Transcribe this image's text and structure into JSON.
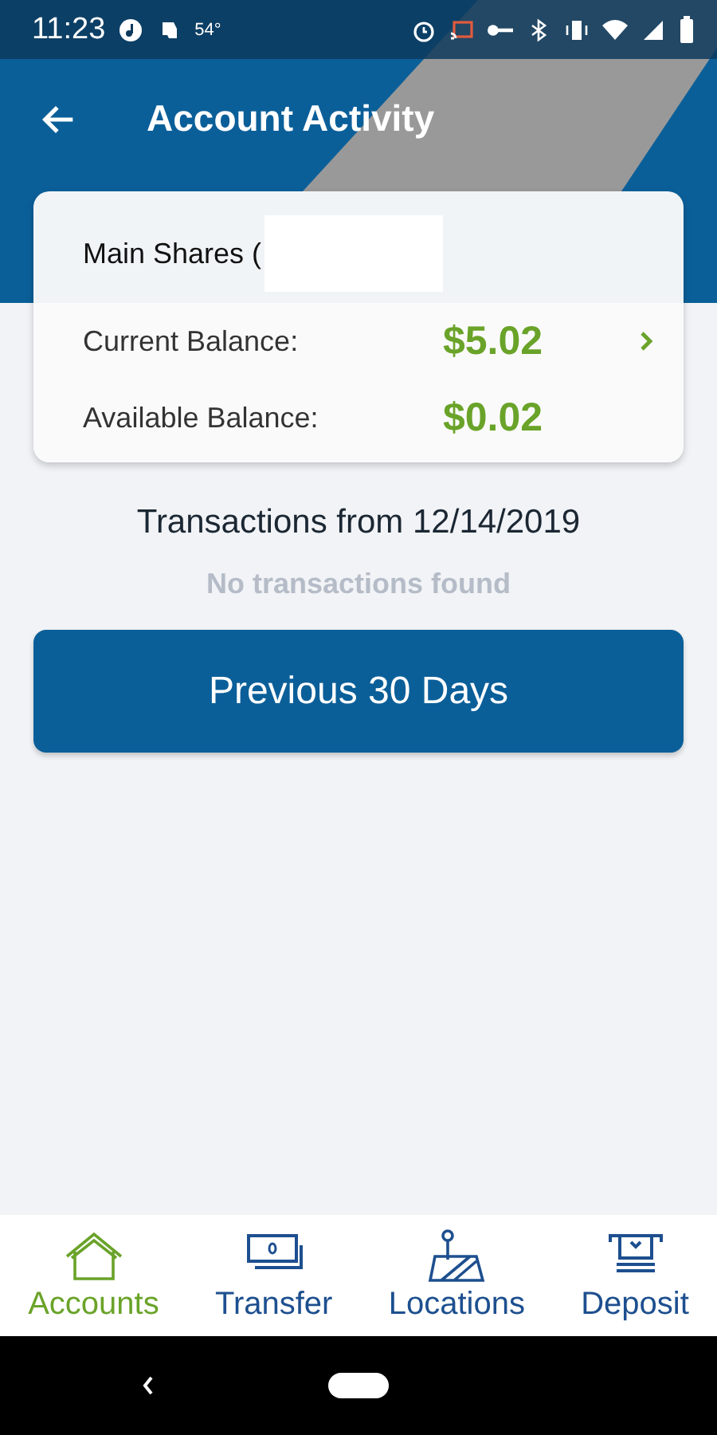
{
  "status_bar": {
    "time": "11:23",
    "temperature": "54°"
  },
  "header": {
    "title": "Account Activity"
  },
  "account": {
    "name": "Main Shares (",
    "balances": [
      {
        "label": "Current Balance:",
        "amount": "$5.02",
        "link": true
      },
      {
        "label": "Available Balance:",
        "amount": "$0.02",
        "link": false
      }
    ]
  },
  "transactions": {
    "heading": "Transactions from 12/14/2019",
    "empty_message": "No transactions found"
  },
  "previous_button": "Previous 30 Days",
  "bottom_nav": [
    {
      "label": "Accounts",
      "kind": "home",
      "selected": true
    },
    {
      "label": "Transfer",
      "kind": "money",
      "selected": false
    },
    {
      "label": "Locations",
      "kind": "map",
      "selected": false
    },
    {
      "label": "Deposit",
      "kind": "atm",
      "selected": false
    }
  ]
}
